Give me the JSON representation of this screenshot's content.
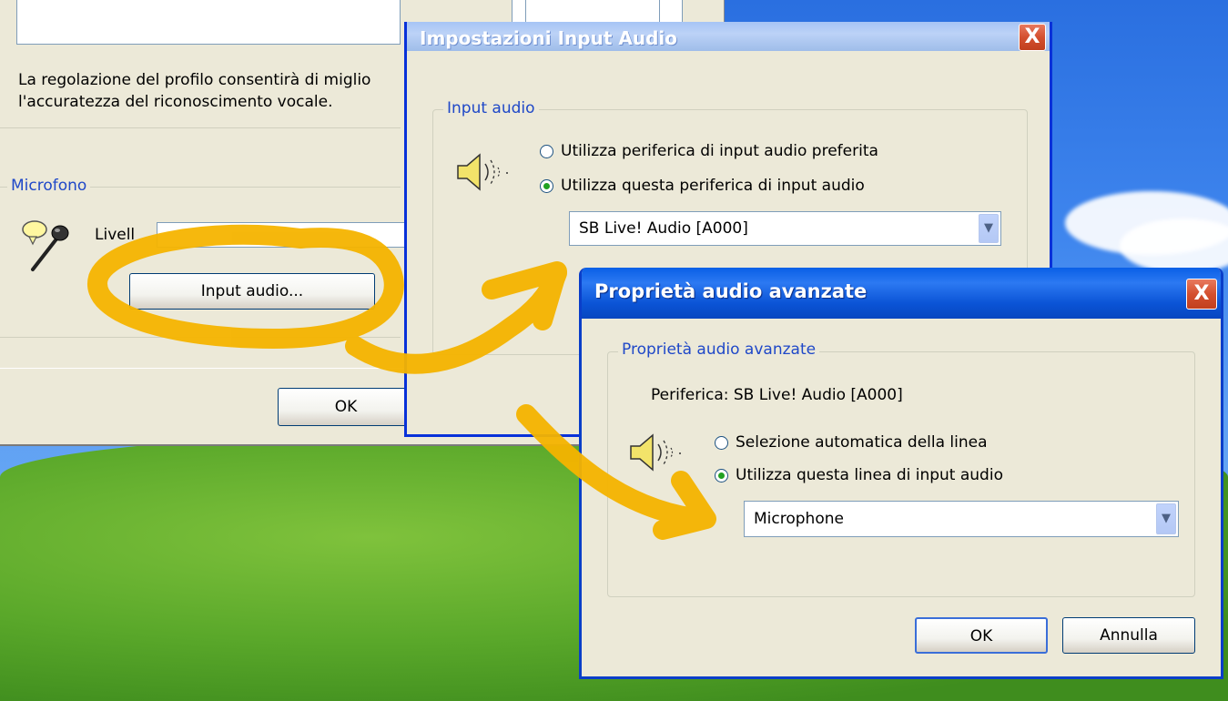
{
  "main_window": {
    "description": "La regolazione del profilo consentirà di miglio\nl'accuratezza del riconoscimento vocale.",
    "microphone_group": "Microfono",
    "level_label": "Livell",
    "input_audio_button": "Input audio...",
    "ok_button": "OK",
    "icons": {
      "microphone": "microphone-icon"
    }
  },
  "input_audio_dialog": {
    "title": "Impostazioni Input Audio",
    "close": "X",
    "group_title": "Input audio",
    "radio_preferred": "Utilizza periferica di input audio preferita",
    "radio_this_device": "Utilizza questa periferica di input audio",
    "selected_radio": "radio_this_device",
    "device_value": "SB Live! Audio [A000]",
    "icons": {
      "speaker": "speaker-icon",
      "dropdown": "chevron-down-icon"
    }
  },
  "advanced_dialog": {
    "title": "Proprietà audio avanzate",
    "close": "X",
    "group_title": "Proprietà audio avanzate",
    "device_line": "Periferica: SB Live! Audio [A000]",
    "radio_auto": "Selezione automatica della linea",
    "radio_this_line": "Utilizza questa linea di input audio",
    "selected_radio": "radio_this_line",
    "line_value": "Microphone",
    "ok_button": "OK",
    "cancel_button": "Annulla",
    "icons": {
      "speaker": "speaker-icon",
      "dropdown": "chevron-down-icon"
    }
  },
  "colors": {
    "annotation": "#f5b400",
    "xp_blue": "#0a5fe6",
    "group_title": "#1f48c8",
    "dialog_bg": "#ece9d8"
  }
}
